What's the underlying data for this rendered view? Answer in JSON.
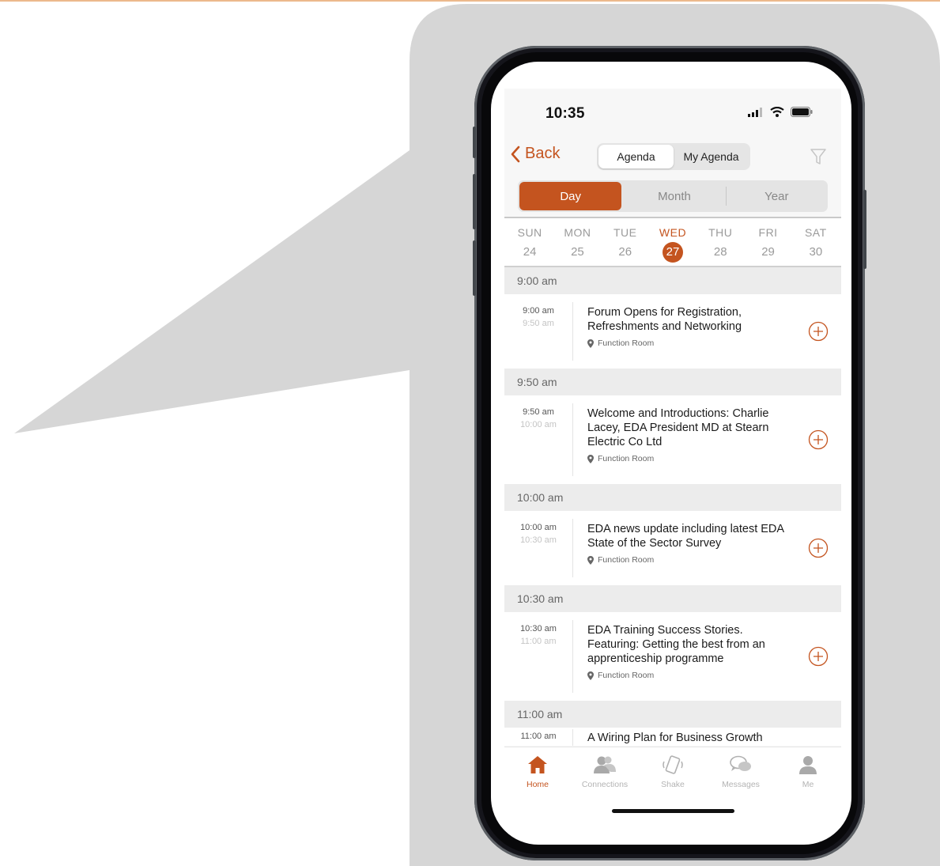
{
  "colors": {
    "accent": "#c4541f",
    "bubble": "#d6d6d6",
    "header_gray": "#ececec"
  },
  "status": {
    "time": "10:35",
    "icons": [
      "signal-icon",
      "wifi-icon",
      "battery-icon"
    ]
  },
  "nav": {
    "back_label": "Back",
    "segments": [
      "Agenda",
      "My Agenda"
    ],
    "selected_segment": "Agenda",
    "filter_icon": "filter-icon"
  },
  "view_tabs": [
    "Day",
    "Month",
    "Year"
  ],
  "selected_view": "Day",
  "week": [
    {
      "name": "SUN",
      "date": "24"
    },
    {
      "name": "MON",
      "date": "25"
    },
    {
      "name": "TUE",
      "date": "26"
    },
    {
      "name": "WED",
      "date": "27"
    },
    {
      "name": "THU",
      "date": "28"
    },
    {
      "name": "FRI",
      "date": "29"
    },
    {
      "name": "SAT",
      "date": "30"
    }
  ],
  "selected_day": "27",
  "sessions": [
    {
      "header": "9:00 am",
      "start": "9:00 am",
      "end": "9:50 am",
      "title": "Forum Opens for Registration, Refreshments and Networking",
      "location": "Function Room"
    },
    {
      "header": "9:50 am",
      "start": "9:50 am",
      "end": "10:00 am",
      "title": "Welcome and Introductions: Charlie Lacey, EDA President MD at Stearn Electric Co Ltd",
      "location": "Function Room"
    },
    {
      "header": "10:00 am",
      "start": "10:00 am",
      "end": "10:30 am",
      "title": "EDA news update including latest EDA State of the Sector Survey",
      "location": "Function Room"
    },
    {
      "header": "10:30 am",
      "start": "10:30 am",
      "end": "11:00 am",
      "title": "EDA Training Success Stories. Featuring: Getting the best from an apprenticeship programme",
      "location": "Function Room"
    },
    {
      "header": "11:00 am",
      "start": "11:00 am",
      "end": "",
      "title": "A Wiring Plan for Business Growth",
      "location": ""
    }
  ],
  "tabbar": [
    {
      "label": "Home",
      "icon": "home-icon",
      "active": true
    },
    {
      "label": "Connections",
      "icon": "connections-icon",
      "active": false
    },
    {
      "label": "Shake",
      "icon": "shake-icon",
      "active": false
    },
    {
      "label": "Messages",
      "icon": "messages-icon",
      "active": false
    },
    {
      "label": "Me",
      "icon": "me-icon",
      "active": false
    }
  ]
}
